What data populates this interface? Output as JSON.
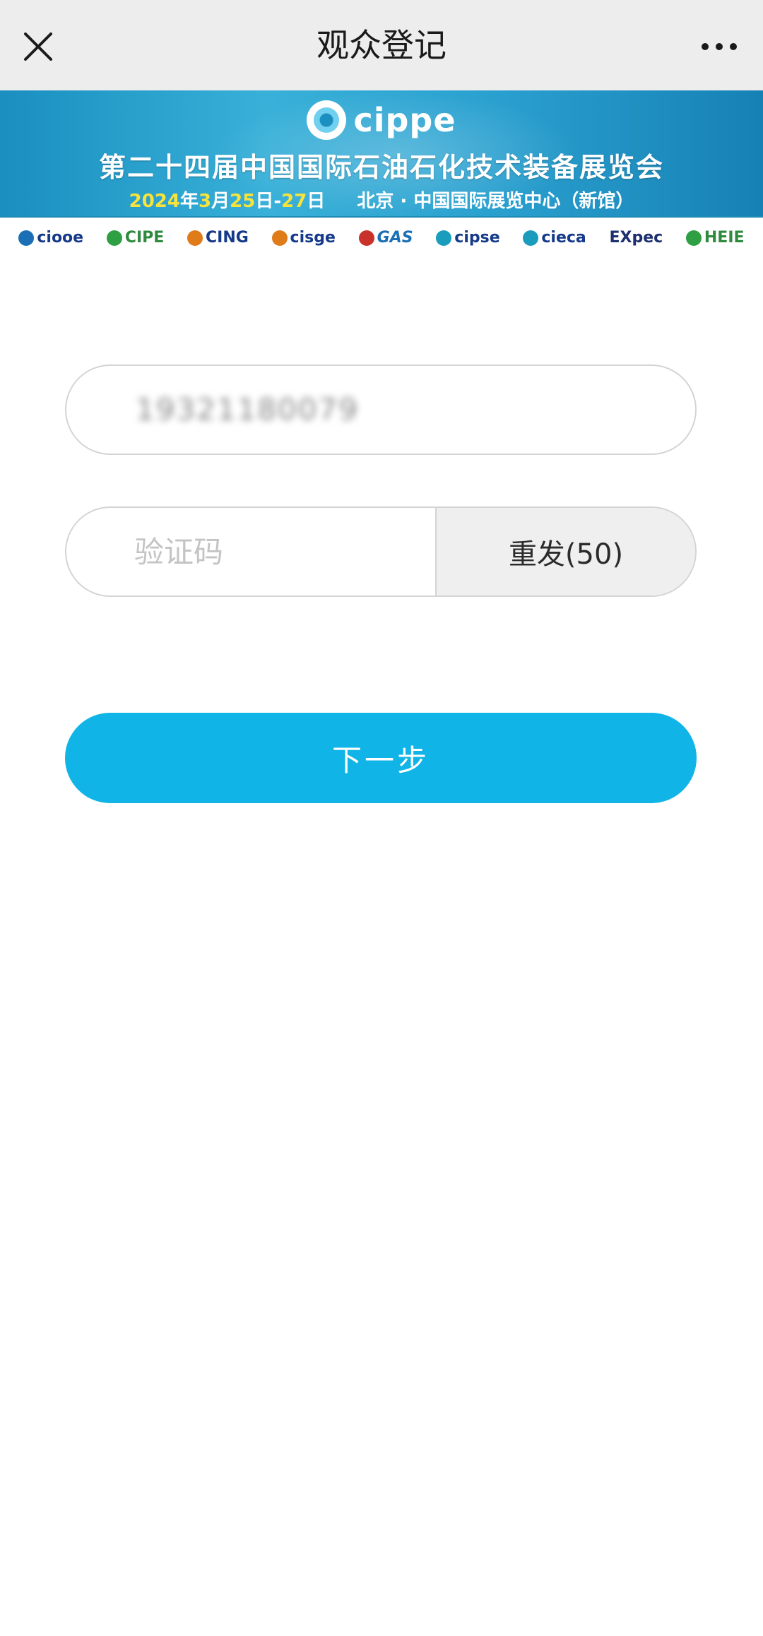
{
  "header": {
    "title": "观众登记",
    "close_icon": "close-icon",
    "more_icon": "more-icon"
  },
  "banner": {
    "brand": "cippe",
    "expo_title": "第二十四届中国国际石油石化技术装备展览会",
    "date_year": "2024",
    "date_year_suffix": "年",
    "date_month": "3",
    "date_month_suffix": "月",
    "date_start": "25",
    "date_start_suffix": "日-",
    "date_end": "27",
    "date_end_suffix": "日",
    "venue": "北京 · 中国国际展览中心（新馆）",
    "partner_logos": [
      "ciooe",
      "CIPE",
      "CING",
      "cisge",
      "GAS",
      "cipse",
      "cieca",
      "EXpec",
      "HEIE"
    ]
  },
  "form": {
    "phone_value": "19321180079",
    "code_placeholder": "验证码",
    "resend_label": "重发(50)",
    "next_label": "下一步"
  },
  "colors": {
    "accent": "#10b4e6",
    "banner": "#2aa0cf",
    "title_bar": "#ededed"
  }
}
